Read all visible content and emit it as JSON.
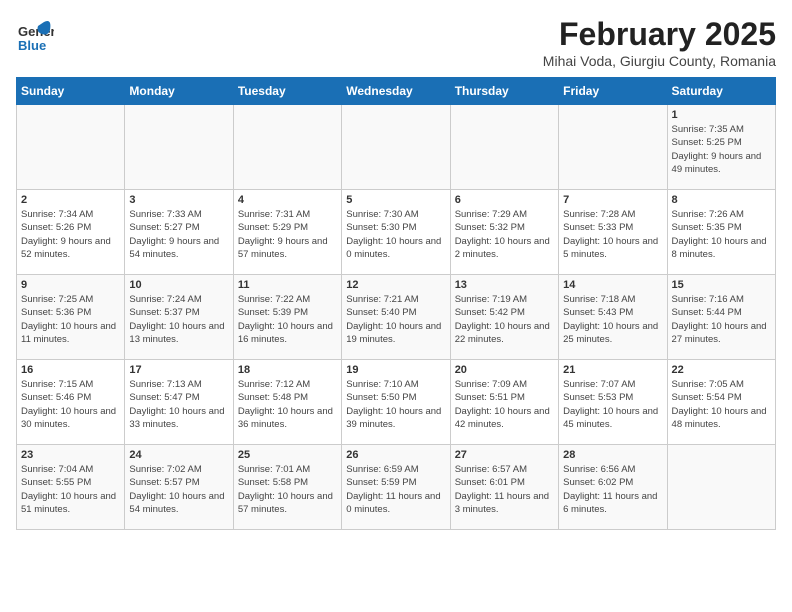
{
  "logo": {
    "general": "General",
    "blue": "Blue"
  },
  "header": {
    "title": "February 2025",
    "subtitle": "Mihai Voda, Giurgiu County, Romania"
  },
  "weekdays": [
    "Sunday",
    "Monday",
    "Tuesday",
    "Wednesday",
    "Thursday",
    "Friday",
    "Saturday"
  ],
  "weeks": [
    [
      {
        "day": "",
        "info": ""
      },
      {
        "day": "",
        "info": ""
      },
      {
        "day": "",
        "info": ""
      },
      {
        "day": "",
        "info": ""
      },
      {
        "day": "",
        "info": ""
      },
      {
        "day": "",
        "info": ""
      },
      {
        "day": "1",
        "info": "Sunrise: 7:35 AM\nSunset: 5:25 PM\nDaylight: 9 hours and 49 minutes."
      }
    ],
    [
      {
        "day": "2",
        "info": "Sunrise: 7:34 AM\nSunset: 5:26 PM\nDaylight: 9 hours and 52 minutes."
      },
      {
        "day": "3",
        "info": "Sunrise: 7:33 AM\nSunset: 5:27 PM\nDaylight: 9 hours and 54 minutes."
      },
      {
        "day": "4",
        "info": "Sunrise: 7:31 AM\nSunset: 5:29 PM\nDaylight: 9 hours and 57 minutes."
      },
      {
        "day": "5",
        "info": "Sunrise: 7:30 AM\nSunset: 5:30 PM\nDaylight: 10 hours and 0 minutes."
      },
      {
        "day": "6",
        "info": "Sunrise: 7:29 AM\nSunset: 5:32 PM\nDaylight: 10 hours and 2 minutes."
      },
      {
        "day": "7",
        "info": "Sunrise: 7:28 AM\nSunset: 5:33 PM\nDaylight: 10 hours and 5 minutes."
      },
      {
        "day": "8",
        "info": "Sunrise: 7:26 AM\nSunset: 5:35 PM\nDaylight: 10 hours and 8 minutes."
      }
    ],
    [
      {
        "day": "9",
        "info": "Sunrise: 7:25 AM\nSunset: 5:36 PM\nDaylight: 10 hours and 11 minutes."
      },
      {
        "day": "10",
        "info": "Sunrise: 7:24 AM\nSunset: 5:37 PM\nDaylight: 10 hours and 13 minutes."
      },
      {
        "day": "11",
        "info": "Sunrise: 7:22 AM\nSunset: 5:39 PM\nDaylight: 10 hours and 16 minutes."
      },
      {
        "day": "12",
        "info": "Sunrise: 7:21 AM\nSunset: 5:40 PM\nDaylight: 10 hours and 19 minutes."
      },
      {
        "day": "13",
        "info": "Sunrise: 7:19 AM\nSunset: 5:42 PM\nDaylight: 10 hours and 22 minutes."
      },
      {
        "day": "14",
        "info": "Sunrise: 7:18 AM\nSunset: 5:43 PM\nDaylight: 10 hours and 25 minutes."
      },
      {
        "day": "15",
        "info": "Sunrise: 7:16 AM\nSunset: 5:44 PM\nDaylight: 10 hours and 27 minutes."
      }
    ],
    [
      {
        "day": "16",
        "info": "Sunrise: 7:15 AM\nSunset: 5:46 PM\nDaylight: 10 hours and 30 minutes."
      },
      {
        "day": "17",
        "info": "Sunrise: 7:13 AM\nSunset: 5:47 PM\nDaylight: 10 hours and 33 minutes."
      },
      {
        "day": "18",
        "info": "Sunrise: 7:12 AM\nSunset: 5:48 PM\nDaylight: 10 hours and 36 minutes."
      },
      {
        "day": "19",
        "info": "Sunrise: 7:10 AM\nSunset: 5:50 PM\nDaylight: 10 hours and 39 minutes."
      },
      {
        "day": "20",
        "info": "Sunrise: 7:09 AM\nSunset: 5:51 PM\nDaylight: 10 hours and 42 minutes."
      },
      {
        "day": "21",
        "info": "Sunrise: 7:07 AM\nSunset: 5:53 PM\nDaylight: 10 hours and 45 minutes."
      },
      {
        "day": "22",
        "info": "Sunrise: 7:05 AM\nSunset: 5:54 PM\nDaylight: 10 hours and 48 minutes."
      }
    ],
    [
      {
        "day": "23",
        "info": "Sunrise: 7:04 AM\nSunset: 5:55 PM\nDaylight: 10 hours and 51 minutes."
      },
      {
        "day": "24",
        "info": "Sunrise: 7:02 AM\nSunset: 5:57 PM\nDaylight: 10 hours and 54 minutes."
      },
      {
        "day": "25",
        "info": "Sunrise: 7:01 AM\nSunset: 5:58 PM\nDaylight: 10 hours and 57 minutes."
      },
      {
        "day": "26",
        "info": "Sunrise: 6:59 AM\nSunset: 5:59 PM\nDaylight: 11 hours and 0 minutes."
      },
      {
        "day": "27",
        "info": "Sunrise: 6:57 AM\nSunset: 6:01 PM\nDaylight: 11 hours and 3 minutes."
      },
      {
        "day": "28",
        "info": "Sunrise: 6:56 AM\nSunset: 6:02 PM\nDaylight: 11 hours and 6 minutes."
      },
      {
        "day": "",
        "info": ""
      }
    ]
  ]
}
